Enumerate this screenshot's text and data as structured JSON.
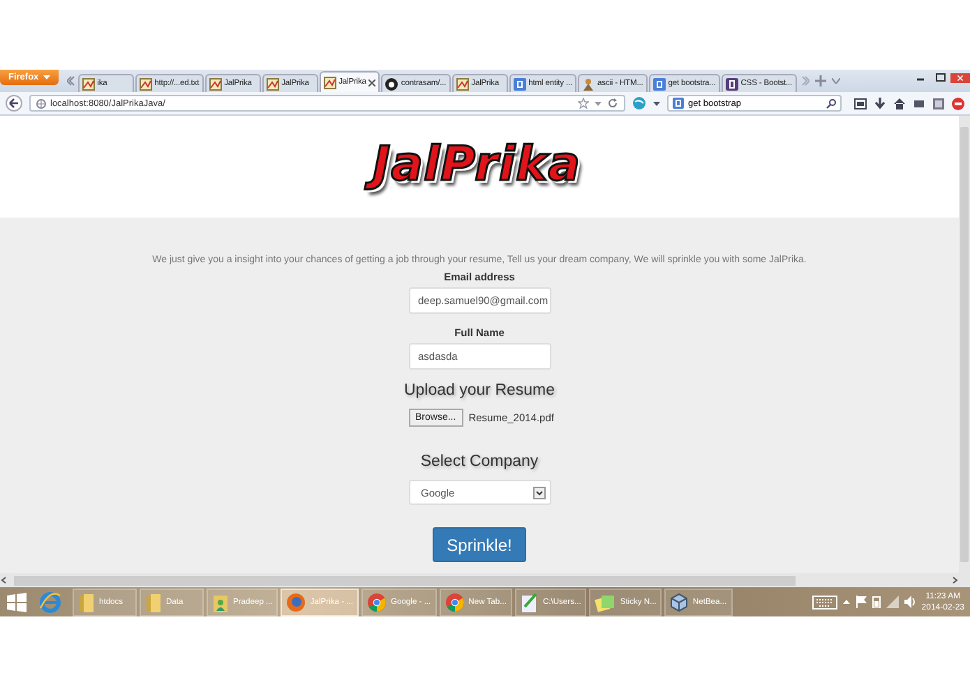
{
  "browser": {
    "menu_button": "Firefox",
    "tabs": [
      {
        "label": "ika",
        "kind": "page",
        "selected": false
      },
      {
        "label": "http://...ed.txt",
        "kind": "page",
        "selected": false
      },
      {
        "label": "JalPrika",
        "kind": "page",
        "selected": false
      },
      {
        "label": "JalPrika",
        "kind": "page",
        "selected": false
      },
      {
        "label": "JalPrika",
        "kind": "page",
        "selected": true
      },
      {
        "label": "contrasam/...",
        "kind": "github",
        "selected": false
      },
      {
        "label": "JalPrika",
        "kind": "page",
        "selected": false
      },
      {
        "label": "html entity ...",
        "kind": "google",
        "selected": false
      },
      {
        "label": "ascii - HTM...",
        "kind": "ascii",
        "selected": false
      },
      {
        "label": "get bootstra...",
        "kind": "google",
        "selected": false
      },
      {
        "label": "CSS - Bootst...",
        "kind": "bootstrap",
        "selected": false
      }
    ],
    "url": "localhost:8080/JalPrikaJava/",
    "search": "get bootstrap"
  },
  "page": {
    "logo": "JalPrika",
    "tagline": "We just give you a insight into your chances of getting a job through your resume, Tell us your dream company, We will sprinkle you with some JalPrika.",
    "email_label": "Email address",
    "email_value": "deep.samuel90@gmail.com",
    "name_label": "Full Name",
    "name_value": "asdasda",
    "upload_heading": "Upload your Resume",
    "browse_button": "Browse...",
    "file_name": "Resume_2014.pdf",
    "company_heading": "Select Company",
    "company_value": "Google",
    "submit_button": "Sprinkle!"
  },
  "taskbar": {
    "items": [
      {
        "label": "htdocs",
        "kind": "folder",
        "selected": false
      },
      {
        "label": "Data",
        "kind": "folder",
        "selected": false
      },
      {
        "label": "Pradeep ...",
        "kind": "user-folder",
        "selected": false
      },
      {
        "label": "JalPrika - ...",
        "kind": "firefox",
        "selected": true
      },
      {
        "label": "Google - ...",
        "kind": "chrome",
        "selected": false
      },
      {
        "label": "New Tab...",
        "kind": "chrome",
        "selected": false
      },
      {
        "label": "C:\\Users...",
        "kind": "notepad",
        "selected": false
      },
      {
        "label": "Sticky N...",
        "kind": "sticky",
        "selected": false
      },
      {
        "label": "NetBea...",
        "kind": "cube",
        "selected": false
      }
    ],
    "time": "11:23 AM",
    "date": "2014-02-23"
  }
}
